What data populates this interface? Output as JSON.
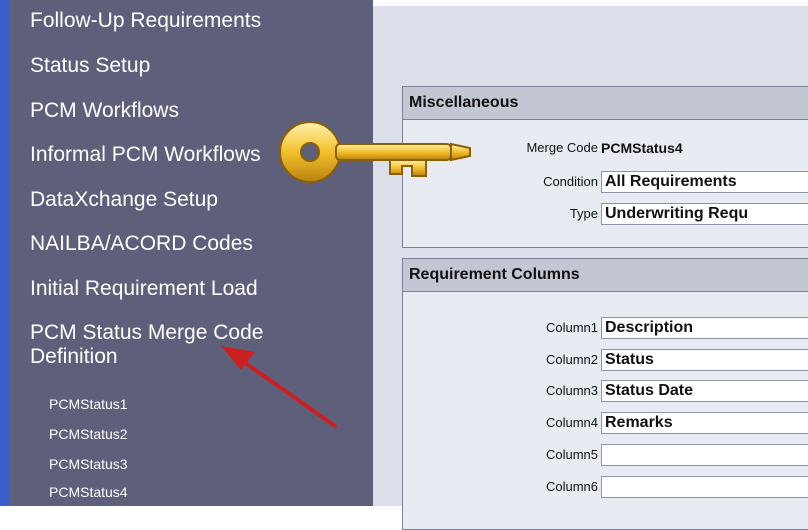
{
  "sidebar": {
    "items": [
      {
        "label": "Follow-Up Requirements"
      },
      {
        "label": "Status Setup"
      },
      {
        "label": "PCM Workflows"
      },
      {
        "label": "Informal PCM Workflows"
      },
      {
        "label": "DataXchange Setup"
      },
      {
        "label": "NAILBA/ACORD Codes"
      },
      {
        "label": "Initial Requirement Load"
      },
      {
        "label": "PCM Status Merge Code Definition"
      }
    ],
    "subitems": [
      {
        "label": "PCMStatus1"
      },
      {
        "label": "PCMStatus2"
      },
      {
        "label": "PCMStatus3"
      },
      {
        "label": "PCMStatus4"
      }
    ]
  },
  "misc": {
    "title": "Miscellaneous",
    "merge_code_label": "Merge Code",
    "merge_code_value": "PCMStatus4",
    "condition_label": "Condition",
    "condition_value": "All Requirements",
    "type_label": "Type",
    "type_value": "Underwriting Requ"
  },
  "req": {
    "title": "Requirement Columns",
    "columns": [
      {
        "label": "Column1",
        "value": "Description"
      },
      {
        "label": "Column2",
        "value": "Status"
      },
      {
        "label": "Column3",
        "value": "Status Date"
      },
      {
        "label": "Column4",
        "value": "Remarks"
      },
      {
        "label": "Column5",
        "value": ""
      },
      {
        "label": "Column6",
        "value": ""
      }
    ]
  },
  "colors": {
    "sidebar_bg": "#5d5f7b",
    "main_bg": "#dcdfe9",
    "accent_strip": "#3a5fcd",
    "arrow": "#cc1f1f",
    "key": "#f3c02b"
  }
}
